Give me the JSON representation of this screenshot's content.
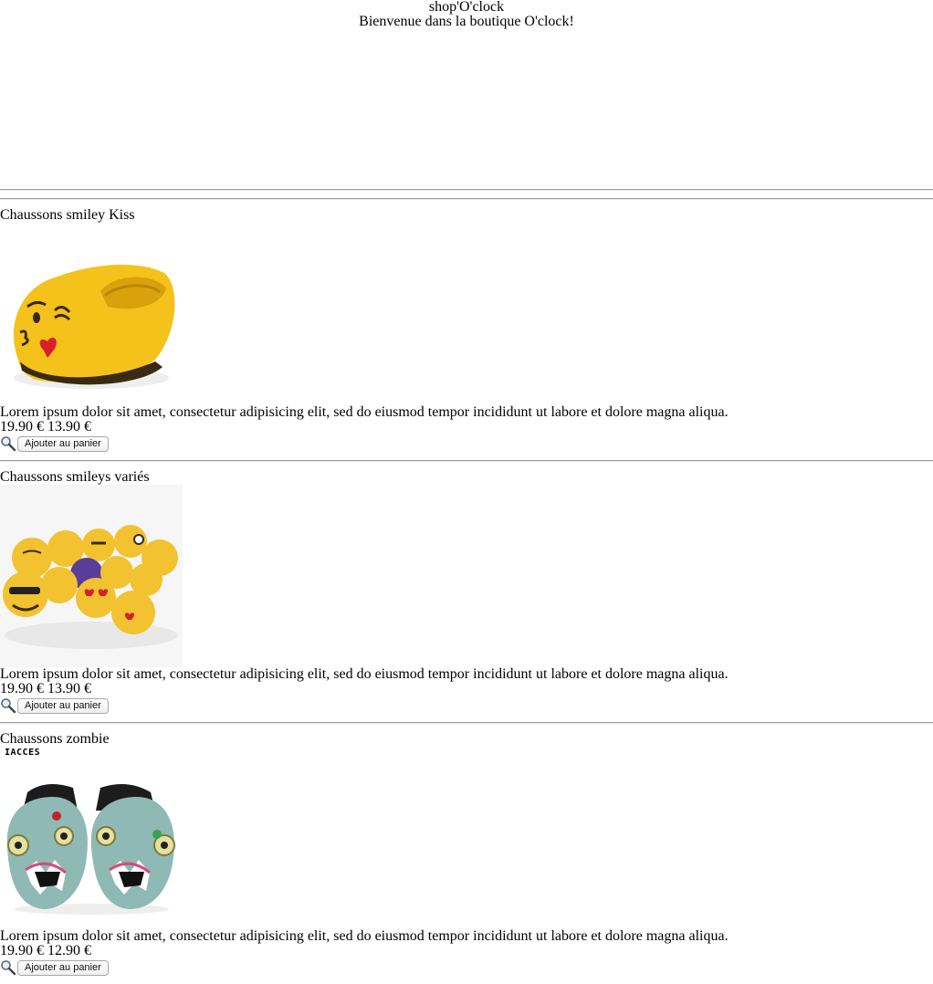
{
  "header": {
    "brand": "shop'O'clock",
    "welcome": "Bienvenue dans la boutique O'clock!"
  },
  "products": [
    {
      "name": "Chaussons smiley Kiss",
      "description": "Lorem ipsum dolor sit amet, consectetur adipisicing elit, sed do eiusmod tempor incididunt ut labore et dolore magna aliqua.",
      "old_price": "19.90 €",
      "price": "13.90 €",
      "cart_label": "Ajouter au panier",
      "image_icon": "emoji-kiss-slipper"
    },
    {
      "name": "Chaussons smileys variés",
      "description": "Lorem ipsum dolor sit amet, consectetur adipisicing elit, sed do eiusmod tempor incididunt ut labore et dolore magna aliqua.",
      "old_price": "19.90 €",
      "price": "13.90 €",
      "cart_label": "Ajouter au panier",
      "image_icon": "emoji-slippers-group"
    },
    {
      "name": "Chaussons zombie",
      "image_caption": "IACCES",
      "description": "Lorem ipsum dolor sit amet, consectetur adipisicing elit, sed do eiusmod tempor incididunt ut labore et dolore magna aliqua.",
      "old_price": "19.90 €",
      "price": "12.90 €",
      "cart_label": "Ajouter au panier",
      "image_icon": "zombie-slippers"
    }
  ],
  "colors": {
    "emoji_yellow": "#f5c518",
    "zombie_teal": "#8fb9b4"
  }
}
